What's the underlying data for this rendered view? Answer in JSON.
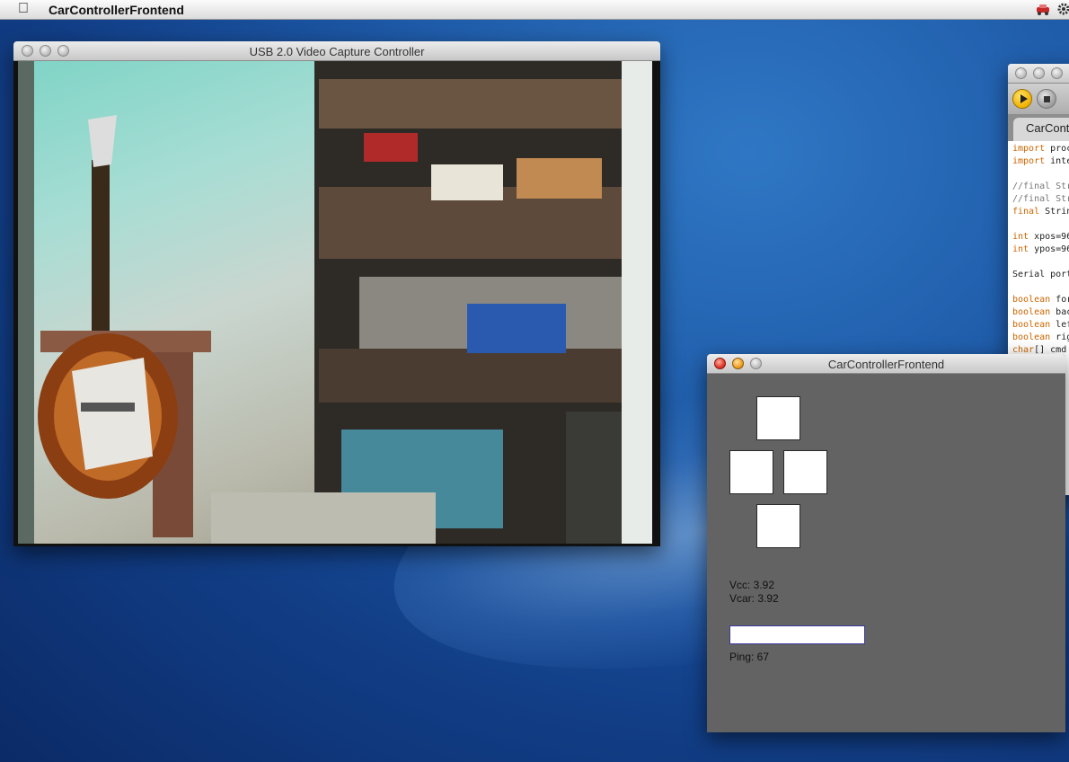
{
  "menubar": {
    "apple_icon": "apple-logo-icon",
    "app_name": "CarControllerFrontend",
    "tray_icons": [
      "car-tray-icon",
      "gear-tray-icon"
    ]
  },
  "video_window": {
    "title": "USB 2.0 Video Capture Controller",
    "content": "live-camera-feed"
  },
  "code_window": {
    "toolbar": [
      "run-icon",
      "stop-icon"
    ],
    "tab_label": "CarContr",
    "lines": [
      {
        "kw": "import",
        "text": " proc"
      },
      {
        "kw": "import",
        "text": " inte"
      },
      {
        "kw": "",
        "text": ""
      },
      {
        "cm": "//final Str"
      },
      {
        "cm": "//final Str"
      },
      {
        "kw": "final",
        "text": " Strin"
      },
      {
        "kw": "",
        "text": ""
      },
      {
        "kw": "int",
        "text": " xpos=96"
      },
      {
        "kw": "int",
        "text": " ypos=96"
      },
      {
        "kw": "",
        "text": ""
      },
      {
        "kw": "",
        "text": "Serial port"
      },
      {
        "kw": "",
        "text": ""
      },
      {
        "kw": "boolean",
        "text": " for"
      },
      {
        "kw": "boolean",
        "text": " bac"
      },
      {
        "kw": "boolean",
        "text": " lef"
      },
      {
        "kw": "boolean",
        "text": " rig"
      },
      {
        "kw": "char",
        "text": "[] cmd"
      }
    ]
  },
  "controller_window": {
    "title": "CarControllerFrontend",
    "vcc_label": "Vcc: 3.92",
    "vcar_label": "Vcar: 3.92",
    "ping_label": "Ping: 67",
    "ping_input_value": ""
  }
}
